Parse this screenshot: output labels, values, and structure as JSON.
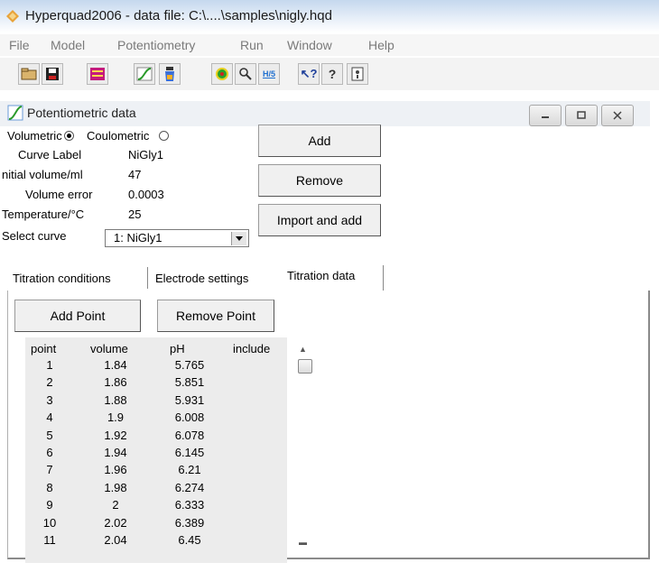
{
  "app": {
    "title": "Hyperquad2006 - data file: C:\\....\\samples\\nigly.hqd"
  },
  "menu": [
    "File",
    "Model",
    "Potentiometry",
    "Run",
    "Window",
    "Help"
  ],
  "toolbar": {
    "icons": [
      "open-folder-icon",
      "save-icon",
      "list-icon",
      "curve-icon",
      "species-icon",
      "target-icon",
      "zoom-icon",
      "ph-icon",
      "help-pointer-icon",
      "help-icon",
      "info-icon"
    ],
    "ph_label": "H/5",
    "help_pointer_label": "↖?",
    "help_label": "?"
  },
  "window": {
    "title": "Potentiometric data"
  },
  "form": {
    "volumetric_label": "Volumetric",
    "coulometric_label": "Coulometric",
    "mode_selected": "Volumetric",
    "curve_label_label": "Curve Label",
    "curve_label_value": "NiGly1",
    "initial_volume_label": "nitial volume/ml",
    "initial_volume_value": "47",
    "volume_error_label": "Volume error",
    "volume_error_value": "0.0003",
    "temperature_label": "Temperature/°C",
    "temperature_value": "25",
    "select_curve_label": "Select curve",
    "select_curve_value": "1:  NiGly1"
  },
  "buttons": {
    "add": "Add",
    "remove": "Remove",
    "import_and_add": "Import and add",
    "add_point": "Add Point",
    "remove_point": "Remove Point"
  },
  "tabs": [
    "Titration conditions",
    "Electrode settings",
    "Titration data"
  ],
  "active_tab": "Titration data",
  "table": {
    "headers": [
      "point",
      "volume",
      "pH",
      "include"
    ],
    "rows": [
      [
        "1",
        "1.84",
        "5.765"
      ],
      [
        "2",
        "1.86",
        "5.851"
      ],
      [
        "3",
        "1.88",
        "5.931"
      ],
      [
        "4",
        "1.9",
        "6.008"
      ],
      [
        "5",
        "1.92",
        "6.078"
      ],
      [
        "6",
        "1.94",
        "6.145"
      ],
      [
        "7",
        "1.96",
        "6.21"
      ],
      [
        "8",
        "1.98",
        "6.274"
      ],
      [
        "9",
        "2",
        "6.333"
      ],
      [
        "10",
        "2.02",
        "6.389"
      ],
      [
        "11",
        "2.04",
        "6.45"
      ]
    ],
    "include_checked": false
  },
  "colors": {
    "titlebar": "#c5d8ee",
    "panel_bg": "#ececec",
    "accent_blue": "#1e6fd0"
  }
}
